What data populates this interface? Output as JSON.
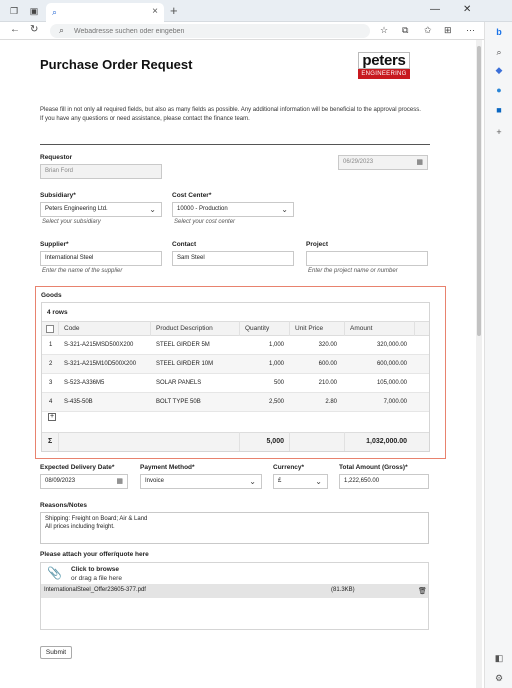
{
  "browser": {
    "address_placeholder": "Webadresse suchen oder eingeben"
  },
  "form": {
    "title": "Purchase Order Request",
    "logo_top": "peters",
    "logo_bottom": "ENGINEERING",
    "intro_1": "Please fill in not only all required fields, but also as many fields as possible. Any additional information will be beneficial to the approval process.",
    "intro_2": "If you have any questions or need assistance, please contact the finance team.",
    "requestor_label": "Requestor",
    "requestor_value": "Brian Ford",
    "date_value": "06/29/2023",
    "subsidiary_label": "Subsidiary*",
    "subsidiary_value": "Peters Engineering Ltd.",
    "subsidiary_hint": "Select your subsidiary",
    "costcenter_label": "Cost Center*",
    "costcenter_value": "10000 - Production",
    "costcenter_hint": "Select your cost center",
    "supplier_label": "Supplier*",
    "supplier_value": "International Steel",
    "supplier_hint": "Enter the name of the supplier",
    "contact_label": "Contact",
    "contact_value": "Sam Steel",
    "project_label": "Project",
    "project_value": "",
    "project_hint": "Enter the project name or number",
    "goods_label": "Goods",
    "goods_rows": "4 rows",
    "columns": [
      "Code",
      "Product Description",
      "Quantity",
      "Unit Price",
      "Amount"
    ],
    "rows": [
      {
        "n": "1",
        "code": "S-321-A215MSD500X200",
        "desc": "STEEL GIRDER 5M",
        "qty": "1,000",
        "price": "320.00",
        "amount": "320,000.00"
      },
      {
        "n": "2",
        "code": "S-321-A215M10D500X200",
        "desc": "STEEL GIRDER 10M",
        "qty": "1,000",
        "price": "600.00",
        "amount": "600,000.00"
      },
      {
        "n": "3",
        "code": "S-523-A336M5",
        "desc": "SOLAR PANELS",
        "qty": "500",
        "price": "210.00",
        "amount": "105,000.00"
      },
      {
        "n": "4",
        "code": "S-435-50B",
        "desc": "BOLT TYPE 50B",
        "qty": "2,500",
        "price": "2.80",
        "amount": "7,000.00"
      }
    ],
    "total_qty": "5,000",
    "total_amount": "1,032,000.00",
    "sigma": "Σ",
    "delivery_label": "Expected Delivery Date*",
    "delivery_value": "08/09/2023",
    "payment_label": "Payment Method*",
    "payment_value": "Invoice",
    "currency_label": "Currency*",
    "currency_value": "£",
    "total_label": "Total Amount (Gross)*",
    "total_value": "1,222,650.00",
    "reasons_label": "Reasons/Notes",
    "reasons_value": "Shipping: Freight on Board; Air & Land\nAll prices including freight.",
    "attach_label": "Please attach your offer/quote here",
    "browse_bold": "Click to browse",
    "browse_sub": "or drag a file here",
    "file_name": "InternationalSteel_Offer23605-377.pdf",
    "file_size": "(81.3KB)",
    "submit_label": "Submit"
  }
}
